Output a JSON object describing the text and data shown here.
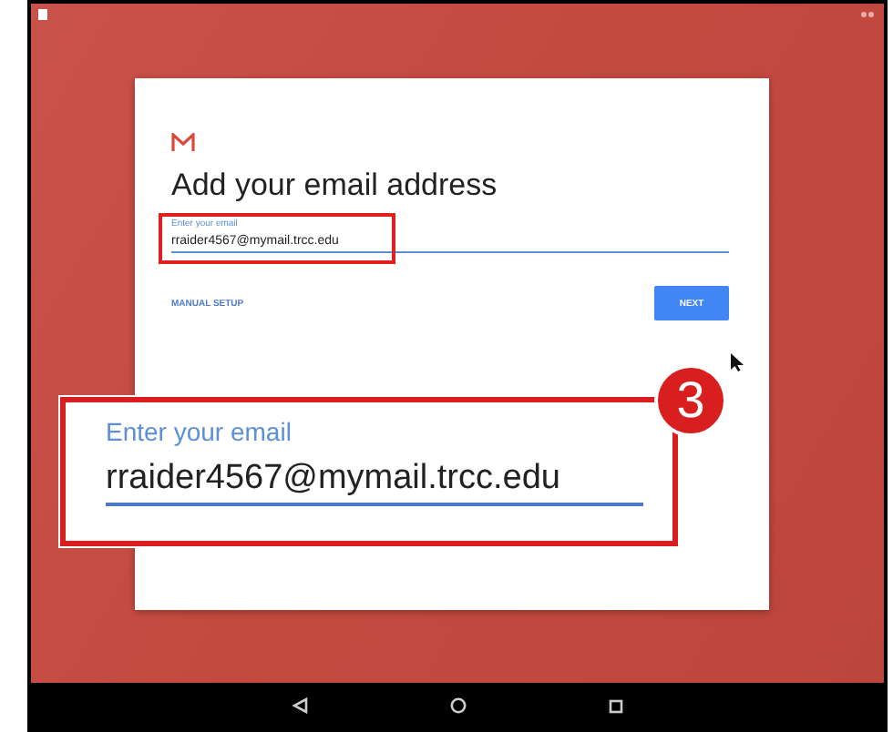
{
  "card": {
    "title": "Add your email address",
    "email_field": {
      "label": "Enter your email",
      "value": "rraider4567@mymail.trcc.edu"
    },
    "buttons": [
      {
        "label": "MANUAL SETUP",
        "kind": "text"
      },
      {
        "label": "NEXT",
        "kind": "filled"
      }
    ]
  },
  "callout": {
    "step": "3",
    "label": "Enter your email",
    "value": "rraider4567@mymail.trcc.edu"
  }
}
